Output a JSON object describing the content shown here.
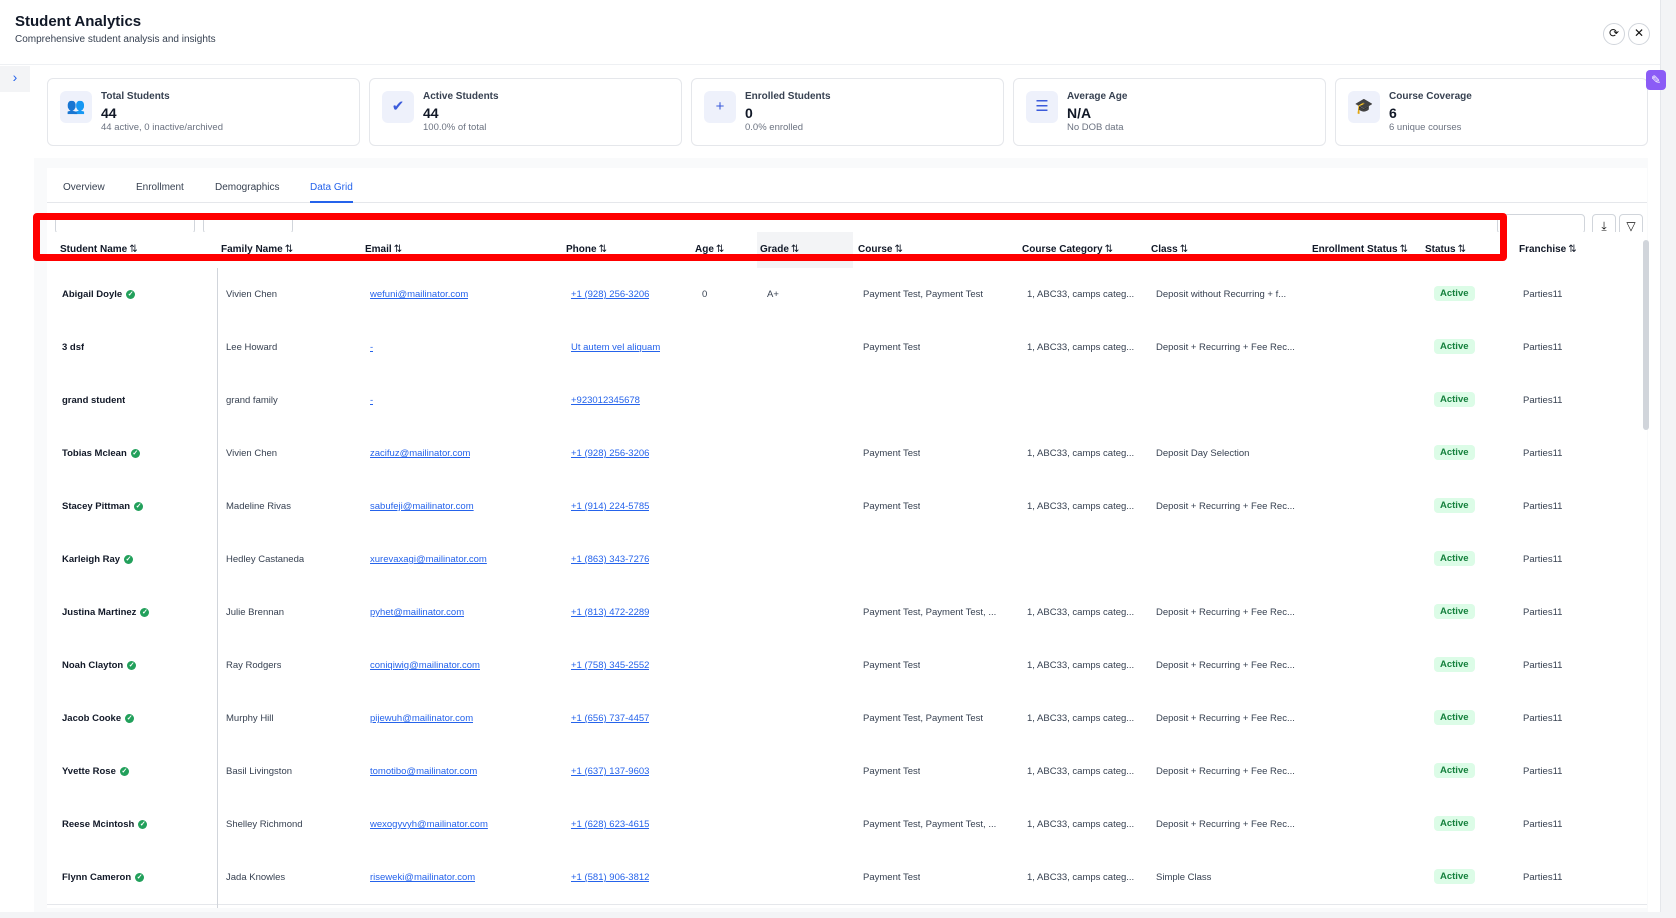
{
  "header": {
    "title": "Student Analytics",
    "subtitle": "Comprehensive student analysis and insights",
    "refresh_icon": "refresh-icon",
    "close_icon": "close-icon"
  },
  "cards": [
    {
      "label": "Total Students",
      "value": "44",
      "sub": "44 active, 0 inactive/archived",
      "icon": "users-icon"
    },
    {
      "label": "Active Students",
      "value": "44",
      "sub": "100.0% of total",
      "icon": "user-check-icon"
    },
    {
      "label": "Enrolled Students",
      "value": "0",
      "sub": "0.0% enrolled",
      "icon": "user-plus-icon"
    },
    {
      "label": "Average Age",
      "value": "N/A",
      "sub": "No DOB data",
      "icon": "bar-chart-icon"
    },
    {
      "label": "Course Coverage",
      "value": "6",
      "sub": "6 unique courses",
      "icon": "graduation-cap-icon"
    }
  ],
  "tabs": [
    "Overview",
    "Enrollment",
    "Demographics",
    "Data Grid"
  ],
  "active_tab": "Data Grid",
  "columns": [
    "Student Name",
    "Family Name",
    "Email",
    "Phone",
    "Age",
    "Grade",
    "Course",
    "Course Category",
    "Class",
    "Enrollment Status",
    "Status",
    "Franchise"
  ],
  "rows": [
    {
      "name": "Abigail Doyle",
      "verified": true,
      "family": "Vivien Chen",
      "email": "wefuni@mailinator.com",
      "phone": "+1 (928) 256-3206",
      "age": "0",
      "grade": "A+",
      "course": "Payment Test, Payment Test",
      "category": "1, ABC33, camps categ...",
      "class": "Deposit without Recurring + f...",
      "status": "Active",
      "franchise": "Parties11"
    },
    {
      "name": "3 dsf",
      "verified": false,
      "family": "Lee Howard",
      "email": "-",
      "phone": "Ut autem vel aliquam",
      "age": "",
      "grade": "",
      "course": "Payment Test",
      "category": "1, ABC33, camps categ...",
      "class": "Deposit + Recurring + Fee Rec...",
      "status": "Active",
      "franchise": "Parties11"
    },
    {
      "name": "grand student",
      "verified": false,
      "family": "grand family",
      "email": "-",
      "phone": "+923012345678",
      "age": "",
      "grade": "",
      "course": "",
      "category": "",
      "class": "",
      "status": "Active",
      "franchise": "Parties11"
    },
    {
      "name": "Tobias Mclean",
      "verified": true,
      "family": "Vivien Chen",
      "email": "zacifuz@mailinator.com",
      "phone": "+1 (928) 256-3206",
      "age": "",
      "grade": "",
      "course": "Payment Test",
      "category": "1, ABC33, camps categ...",
      "class": "Deposit Day Selection",
      "status": "Active",
      "franchise": "Parties11"
    },
    {
      "name": "Stacey Pittman",
      "verified": true,
      "family": "Madeline Rivas",
      "email": "sabufeji@mailinator.com",
      "phone": "+1 (914) 224-5785",
      "age": "",
      "grade": "",
      "course": "Payment Test",
      "category": "1, ABC33, camps categ...",
      "class": "Deposit + Recurring + Fee Rec...",
      "status": "Active",
      "franchise": "Parties11"
    },
    {
      "name": "Karleigh Ray",
      "verified": true,
      "family": "Hedley Castaneda",
      "email": "xurevaxagi@mailinator.com",
      "phone": "+1 (863) 343-7276",
      "age": "",
      "grade": "",
      "course": "",
      "category": "",
      "class": "",
      "status": "Active",
      "franchise": "Parties11"
    },
    {
      "name": "Justina Martinez",
      "verified": true,
      "family": "Julie Brennan",
      "email": "pyhet@mailinator.com",
      "phone": "+1 (813) 472-2289",
      "age": "",
      "grade": "",
      "course": "Payment Test, Payment Test, ...",
      "category": "1, ABC33, camps categ...",
      "class": "Deposit + Recurring + Fee Rec...",
      "status": "Active",
      "franchise": "Parties11"
    },
    {
      "name": "Noah Clayton",
      "verified": true,
      "family": "Ray Rodgers",
      "email": "coniqiwig@mailinator.com",
      "phone": "+1 (758) 345-2552",
      "age": "",
      "grade": "",
      "course": "Payment Test",
      "category": "1, ABC33, camps categ...",
      "class": "Deposit + Recurring + Fee Rec...",
      "status": "Active",
      "franchise": "Parties11"
    },
    {
      "name": "Jacob Cooke",
      "verified": true,
      "family": "Murphy Hill",
      "email": "pijewuh@mailinator.com",
      "phone": "+1 (656) 737-4457",
      "age": "",
      "grade": "",
      "course": "Payment Test, Payment Test",
      "category": "1, ABC33, camps categ...",
      "class": "Deposit + Recurring + Fee Rec...",
      "status": "Active",
      "franchise": "Parties11"
    },
    {
      "name": "Yvette Rose",
      "verified": true,
      "family": "Basil Livingston",
      "email": "tomotibo@mailinator.com",
      "phone": "+1 (637) 137-9603",
      "age": "",
      "grade": "",
      "course": "Payment Test",
      "category": "1, ABC33, camps categ...",
      "class": "Deposit + Recurring + Fee Rec...",
      "status": "Active",
      "franchise": "Parties11"
    },
    {
      "name": "Reese Mcintosh",
      "verified": true,
      "family": "Shelley Richmond",
      "email": "wexogyvyh@mailinator.com",
      "phone": "+1 (628) 623-4615",
      "age": "",
      "grade": "",
      "course": "Payment Test, Payment Test, ...",
      "category": "1, ABC33, camps categ...",
      "class": "Deposit + Recurring + Fee Rec...",
      "status": "Active",
      "franchise": "Parties11"
    },
    {
      "name": "Flynn Cameron",
      "verified": true,
      "family": "Jada Knowles",
      "email": "riseweki@mailinator.com",
      "phone": "+1 (581) 906-3812",
      "age": "",
      "grade": "",
      "course": "Payment Test",
      "category": "1, ABC33, camps categ...",
      "class": "Simple Class",
      "status": "Active",
      "franchise": "Parties11"
    }
  ],
  "sort_icon": "⇅",
  "grade_sort_icon": "⇅",
  "verified_icon": "check-circle-icon",
  "colors": {
    "accent": "#2563eb",
    "status_active_bg": "#dcfce7",
    "status_active_text": "#15803d",
    "verified": "#22a05b",
    "highlight": "#ff0000"
  }
}
